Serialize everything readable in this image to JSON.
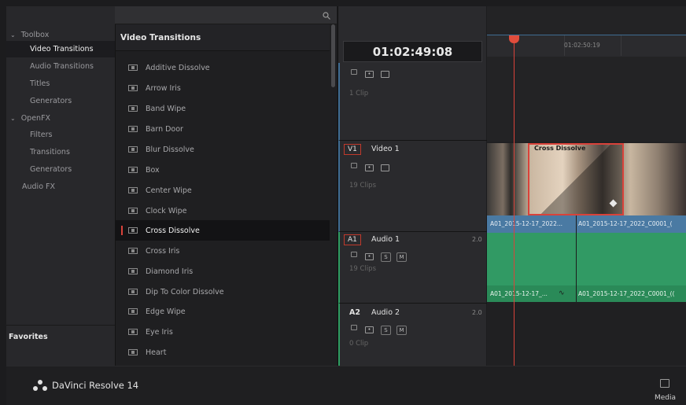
{
  "topbar": {
    "search_icon": "search-icon",
    "view_icon": "panel-toggle-icon"
  },
  "sidebar": {
    "items": [
      {
        "label": "Toolbox",
        "type": "group"
      },
      {
        "label": "Video Transitions",
        "type": "item",
        "selected": true
      },
      {
        "label": "Audio Transitions",
        "type": "item"
      },
      {
        "label": "Titles",
        "type": "item"
      },
      {
        "label": "Generators",
        "type": "item"
      },
      {
        "label": "OpenFX",
        "type": "group"
      },
      {
        "label": "Filters",
        "type": "item"
      },
      {
        "label": "Transitions",
        "type": "item"
      },
      {
        "label": "Generators",
        "type": "item"
      },
      {
        "label": "Audio FX",
        "type": "item"
      }
    ],
    "favorites_label": "Favorites"
  },
  "effects": {
    "header": "Video Transitions",
    "items": [
      "Additive Dissolve",
      "Arrow Iris",
      "Band Wipe",
      "Barn Door",
      "Blur Dissolve",
      "Box",
      "Center Wipe",
      "Clock Wipe",
      "Cross Dissolve",
      "Cross Iris",
      "Diamond Iris",
      "Dip To Color Dissolve",
      "Edge Wipe",
      "Eye Iris",
      "Heart"
    ],
    "selected": "Cross Dissolve"
  },
  "timeline": {
    "timecode": "01:02:49:08",
    "ruler_tc": "01:02:50:19",
    "top_track": {
      "clips": "1 Clip"
    },
    "video_track": {
      "badge": "V1",
      "name": "Video 1",
      "clips": "19 Clips"
    },
    "audio1": {
      "badge": "A1",
      "name": "Audio 1",
      "channels": "2.0",
      "clips": "19 Clips",
      "solo": "S",
      "mute": "M"
    },
    "audio2": {
      "badge": "A2",
      "name": "Audio 2",
      "channels": "2.0",
      "clips": "0 Clip",
      "solo": "S",
      "mute": "M"
    },
    "transition_label": "Cross Dissolve",
    "video_clip_a": "A01_2015-12-17_2022...",
    "video_clip_b": "A01_2015-12-17_2022_C0001_(",
    "audio_clip_a": "A01_2015-12-17_...",
    "audio_clip_b": "A01_2015-12-17_2022_C0001_(("
  },
  "footer": {
    "app_name": "DaVinci Resolve 14",
    "media_label": "Media"
  },
  "colors": {
    "accent": "#d9423a",
    "video_track": "#3f6d93",
    "audio_track": "#2f9e62",
    "background": "#1c1c1e"
  }
}
